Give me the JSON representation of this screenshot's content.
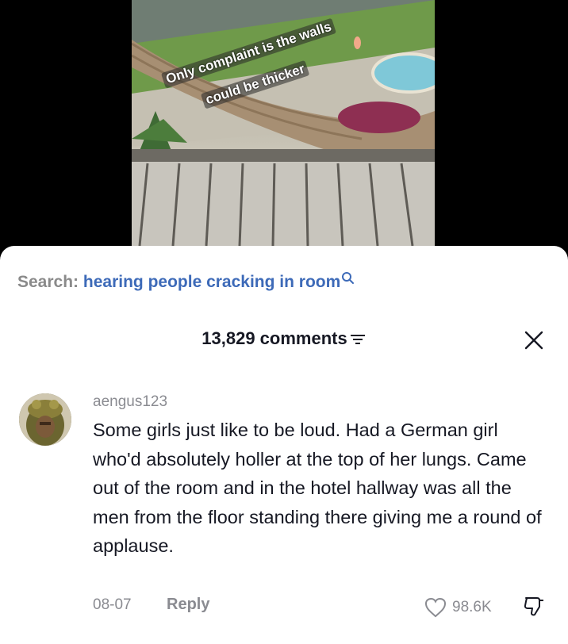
{
  "video": {
    "caption_line1": "Only complaint is the walls",
    "caption_line2": "could be thicker"
  },
  "search": {
    "prefix": "Search:",
    "term": "hearing people cracking in room"
  },
  "comments_header": {
    "count_label": "13,829 comments"
  },
  "comment": {
    "username": "aengus123",
    "text": "Some girls just like to be loud. Had a German girl who'd absolutely holler at the top of her lungs. Came out of the room and in the hotel hallway was all the men from the floor standing there giving me a round of applause.",
    "date": "08-07",
    "reply_label": "Reply",
    "like_count": "98.6K"
  },
  "icons": {
    "search": "magnifier-icon",
    "sort": "filter-lines-icon",
    "close": "close-x-icon",
    "like": "heart-outline-icon",
    "dislike": "thumbs-down-icon"
  },
  "colors": {
    "search_term": "#3d6ab8",
    "muted": "#8a8b91",
    "text": "#161823"
  }
}
